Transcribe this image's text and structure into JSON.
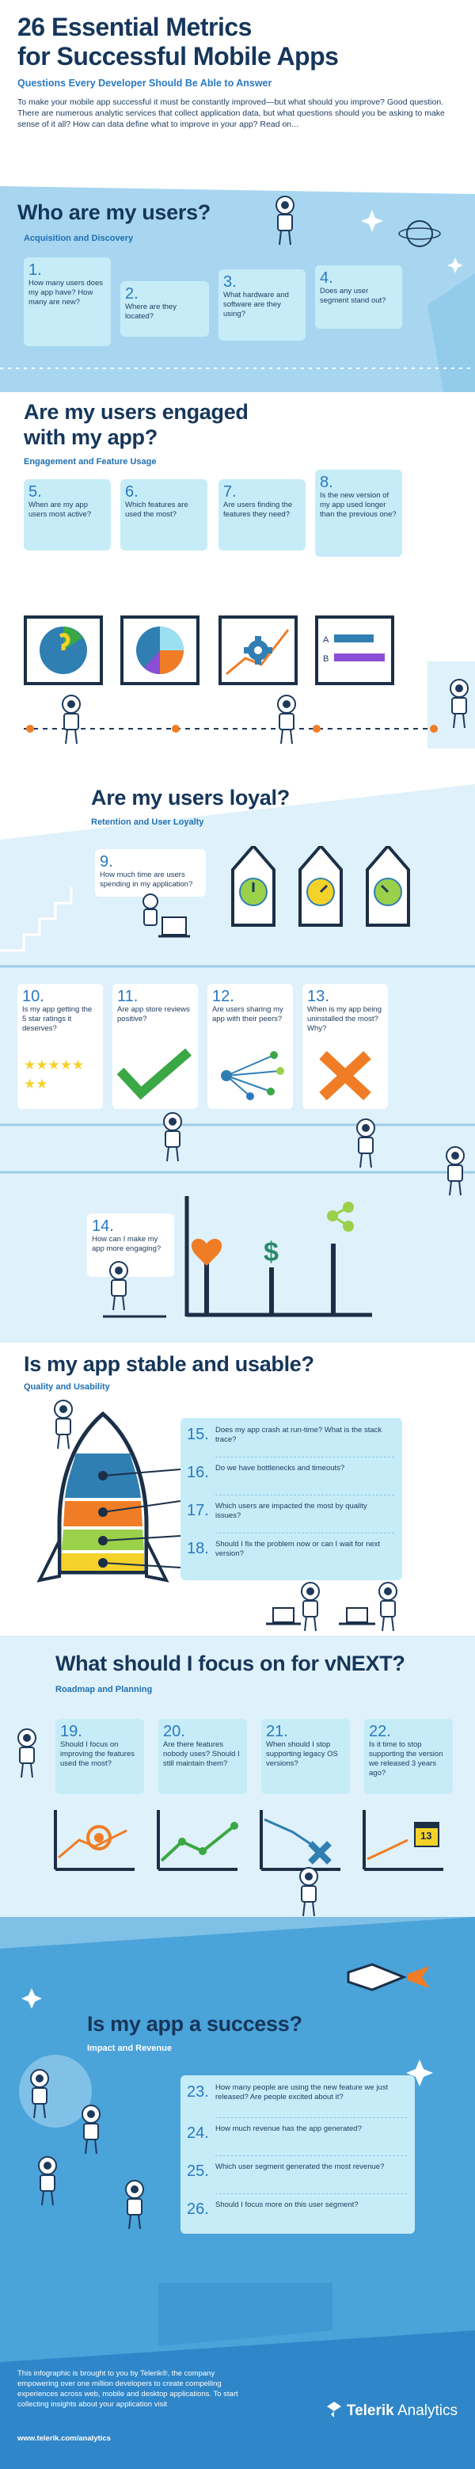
{
  "header": {
    "title_line1": "26 Essential Metrics",
    "title_line2": "for Successful Mobile Apps",
    "subtitle": "Questions Every Developer Should Be Able to Answer",
    "intro": "To make your mobile app successful it must be constantly improved—but what should you improve? Good question. There are numerous analytic services that collect application data, but what questions should you be asking to make sense of it all? How can data define what to improve in your app? Read on..."
  },
  "sections": {
    "users": {
      "title": "Who are my users?",
      "subtitle": "Acquisition and Discovery",
      "items": [
        {
          "n": "1.",
          "q": "How many users does my app have? How many are new?"
        },
        {
          "n": "2.",
          "q": "Where are they located?"
        },
        {
          "n": "3.",
          "q": "What hardware and software are they using?"
        },
        {
          "n": "4.",
          "q": "Does any user segment stand out?"
        }
      ]
    },
    "engaged": {
      "title_line1": "Are my users engaged",
      "title_line2": "with my app?",
      "subtitle": "Engagement and Feature Usage",
      "items": [
        {
          "n": "5.",
          "q": "When are my app users most active?"
        },
        {
          "n": "6.",
          "q": "Which features are used the most?"
        },
        {
          "n": "7.",
          "q": "Are users finding the features they need?"
        },
        {
          "n": "8.",
          "q": "Is the new version of my app used longer than the previous one?"
        }
      ]
    },
    "loyal": {
      "title": "Are my users loyal?",
      "subtitle": "Retention and User Loyalty",
      "item9": {
        "n": "9.",
        "q": "How much time are users spending in my application?"
      },
      "items": [
        {
          "n": "10.",
          "q": "Is my app getting the 5 star ratings it deserves?"
        },
        {
          "n": "11.",
          "q": "Are app store reviews positive?"
        },
        {
          "n": "12.",
          "q": "Are users sharing my app with their peers?"
        },
        {
          "n": "13.",
          "q": "When is my app being uninstalled the most? Why?"
        }
      ],
      "item14": {
        "n": "14.",
        "q": "How can I make my app more engaging?"
      },
      "dollar": "$"
    },
    "stable": {
      "title": "Is my app stable and usable?",
      "subtitle": "Quality and Usability",
      "items": [
        {
          "n": "15.",
          "q": "Does my app crash at run-time? What is the stack trace?"
        },
        {
          "n": "16.",
          "q": "Do we have bottlenecks and timeouts?"
        },
        {
          "n": "17.",
          "q": "Which users are impacted the most by quality issues?"
        },
        {
          "n": "18.",
          "q": "Should I fix the problem now or can I wait for next version?"
        }
      ]
    },
    "vnext": {
      "title": "What should I focus on for vNEXT?",
      "subtitle": "Roadmap and Planning",
      "items": [
        {
          "n": "19.",
          "q": "Should I focus on improving the features used the most?"
        },
        {
          "n": "20.",
          "q": "Are there features nobody uses? Should I still maintain them?"
        },
        {
          "n": "21.",
          "q": "When should I stop supporting legacy OS versions?"
        },
        {
          "n": "22.",
          "q": "Is it time to stop supporting the version we released 3 years ago?"
        }
      ],
      "calendar_number": "13"
    },
    "success": {
      "title": "Is my app a success?",
      "subtitle": "Impact and Revenue",
      "items": [
        {
          "n": "23.",
          "q": "How many people are using the new feature we just released? Are people excited about it?"
        },
        {
          "n": "24.",
          "q": "How much revenue has the app generated?"
        },
        {
          "n": "25.",
          "q": "Which user segment generated the most revenue?"
        },
        {
          "n": "26.",
          "q": "Should I focus more on this user segment?"
        }
      ]
    }
  },
  "footer": {
    "text": "This infographic is brought to you by Telerik®, the company empowering over one million developers to create compelling experiences across web, mobile and desktop applications. To start collecting insights about your application visit",
    "url": "www.telerik.com/analytics",
    "brand_name": "Telerik",
    "brand_product": "Analytics"
  },
  "colors": {
    "navy": "#16365a",
    "accent_blue": "#2a79c0",
    "card": "#c6ecf8",
    "orange": "#f07d25",
    "green": "#3aa845",
    "yellow": "#f5d22a",
    "purple": "#8a4fd6"
  }
}
